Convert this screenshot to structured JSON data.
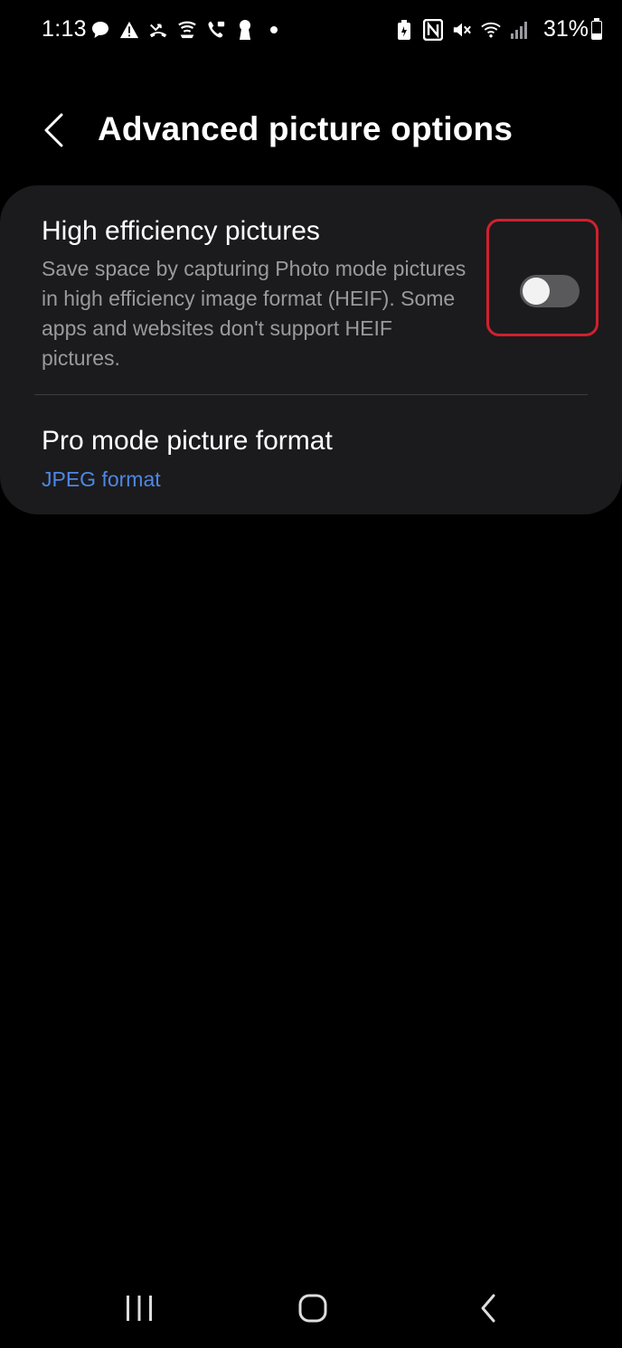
{
  "status_bar": {
    "time": "1:13",
    "battery": "31%",
    "left_icons": [
      "chat-bubble-icon",
      "alert-icon",
      "missed-call-icon",
      "wifi-calling-icon",
      "voicemail-icon",
      "keyhole-icon",
      "dot-icon"
    ],
    "right_icons": [
      "battery-saver-icon",
      "nfc-icon",
      "mute-icon",
      "wifi-icon",
      "signal-icon"
    ]
  },
  "header": {
    "title": "Advanced picture options",
    "back_icon": "chevron-left-icon"
  },
  "settings": {
    "heif": {
      "title": "High efficiency pictures",
      "description": "Save space by capturing Photo mode pictures in high efficiency image format (HEIF). Some apps and websites don't support HEIF pictures.",
      "enabled": false
    },
    "pro_format": {
      "title": "Pro mode picture format",
      "value": "JPEG format"
    }
  },
  "colors": {
    "background": "#000000",
    "card": "#1b1b1d",
    "accent_link": "#4f86e3",
    "highlight": "#d2202f",
    "secondary_text": "#9a9a9e"
  },
  "nav_bar": {
    "icons": [
      "recents-icon",
      "home-icon",
      "back-icon"
    ]
  }
}
